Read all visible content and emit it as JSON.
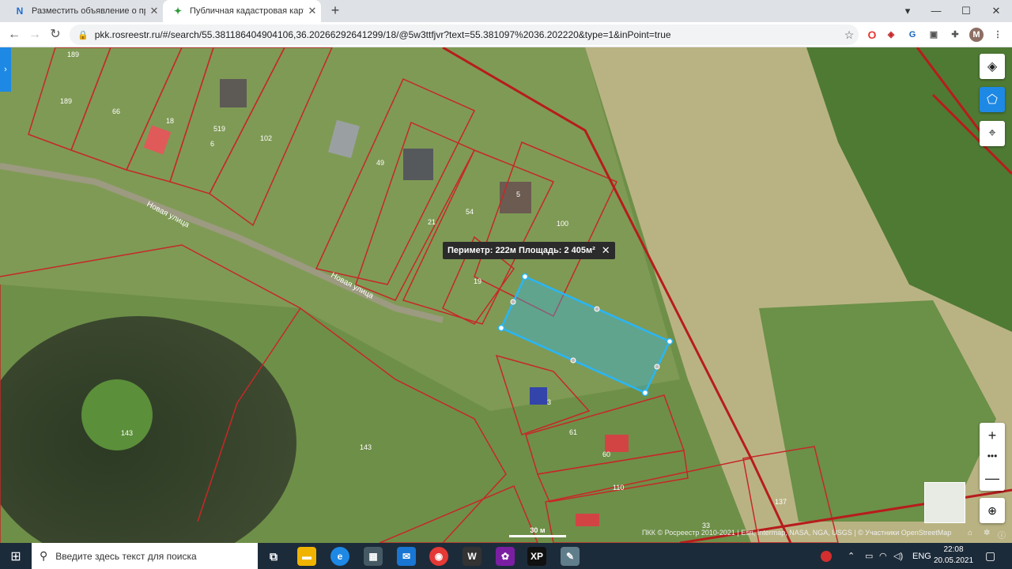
{
  "browser": {
    "tabs": [
      {
        "title": "Разместить объявление о прод",
        "icon": "avito-logo-icon",
        "color": "#1c6cd6"
      },
      {
        "title": "Публичная кадастровая карта",
        "icon": "rosreestr-logo-icon",
        "color": "#2e9d3a"
      }
    ],
    "new_tab_icon": "plus-icon",
    "url": "pkk.rosreestr.ru/#/search/55.381186404904106,36.20266292641299/18/@5w3ttfjvr?text=55.381097%2036.202220&type=1&inPoint=true",
    "profile_initial": "M"
  },
  "map": {
    "measure_tooltip": "Периметр: 222м Площадь: 2 405м²",
    "scale_label": "30 м",
    "attribution": "ПКК © Росреестр 2010-2021 | Esri, Intermap, NASA, NGA, USGS | © Участники OpenStreetMap",
    "street_labels": [
      "Новая улица",
      "Новая улица"
    ],
    "parcel_labels": [
      "189",
      "189",
      "66",
      "18",
      "519",
      "6",
      "102",
      "49",
      "21",
      "54",
      "5",
      "100",
      "19",
      "3",
      "61",
      "60",
      "110",
      "143",
      "143",
      "137",
      "33"
    ],
    "parcel_highlight_color": "#29b6f6",
    "boundary_color": "#c62828"
  },
  "taskbar": {
    "search_placeholder": "Введите здесь текст для поиска",
    "language": "ENG",
    "time": "22:08",
    "date": "20.05.2021"
  }
}
